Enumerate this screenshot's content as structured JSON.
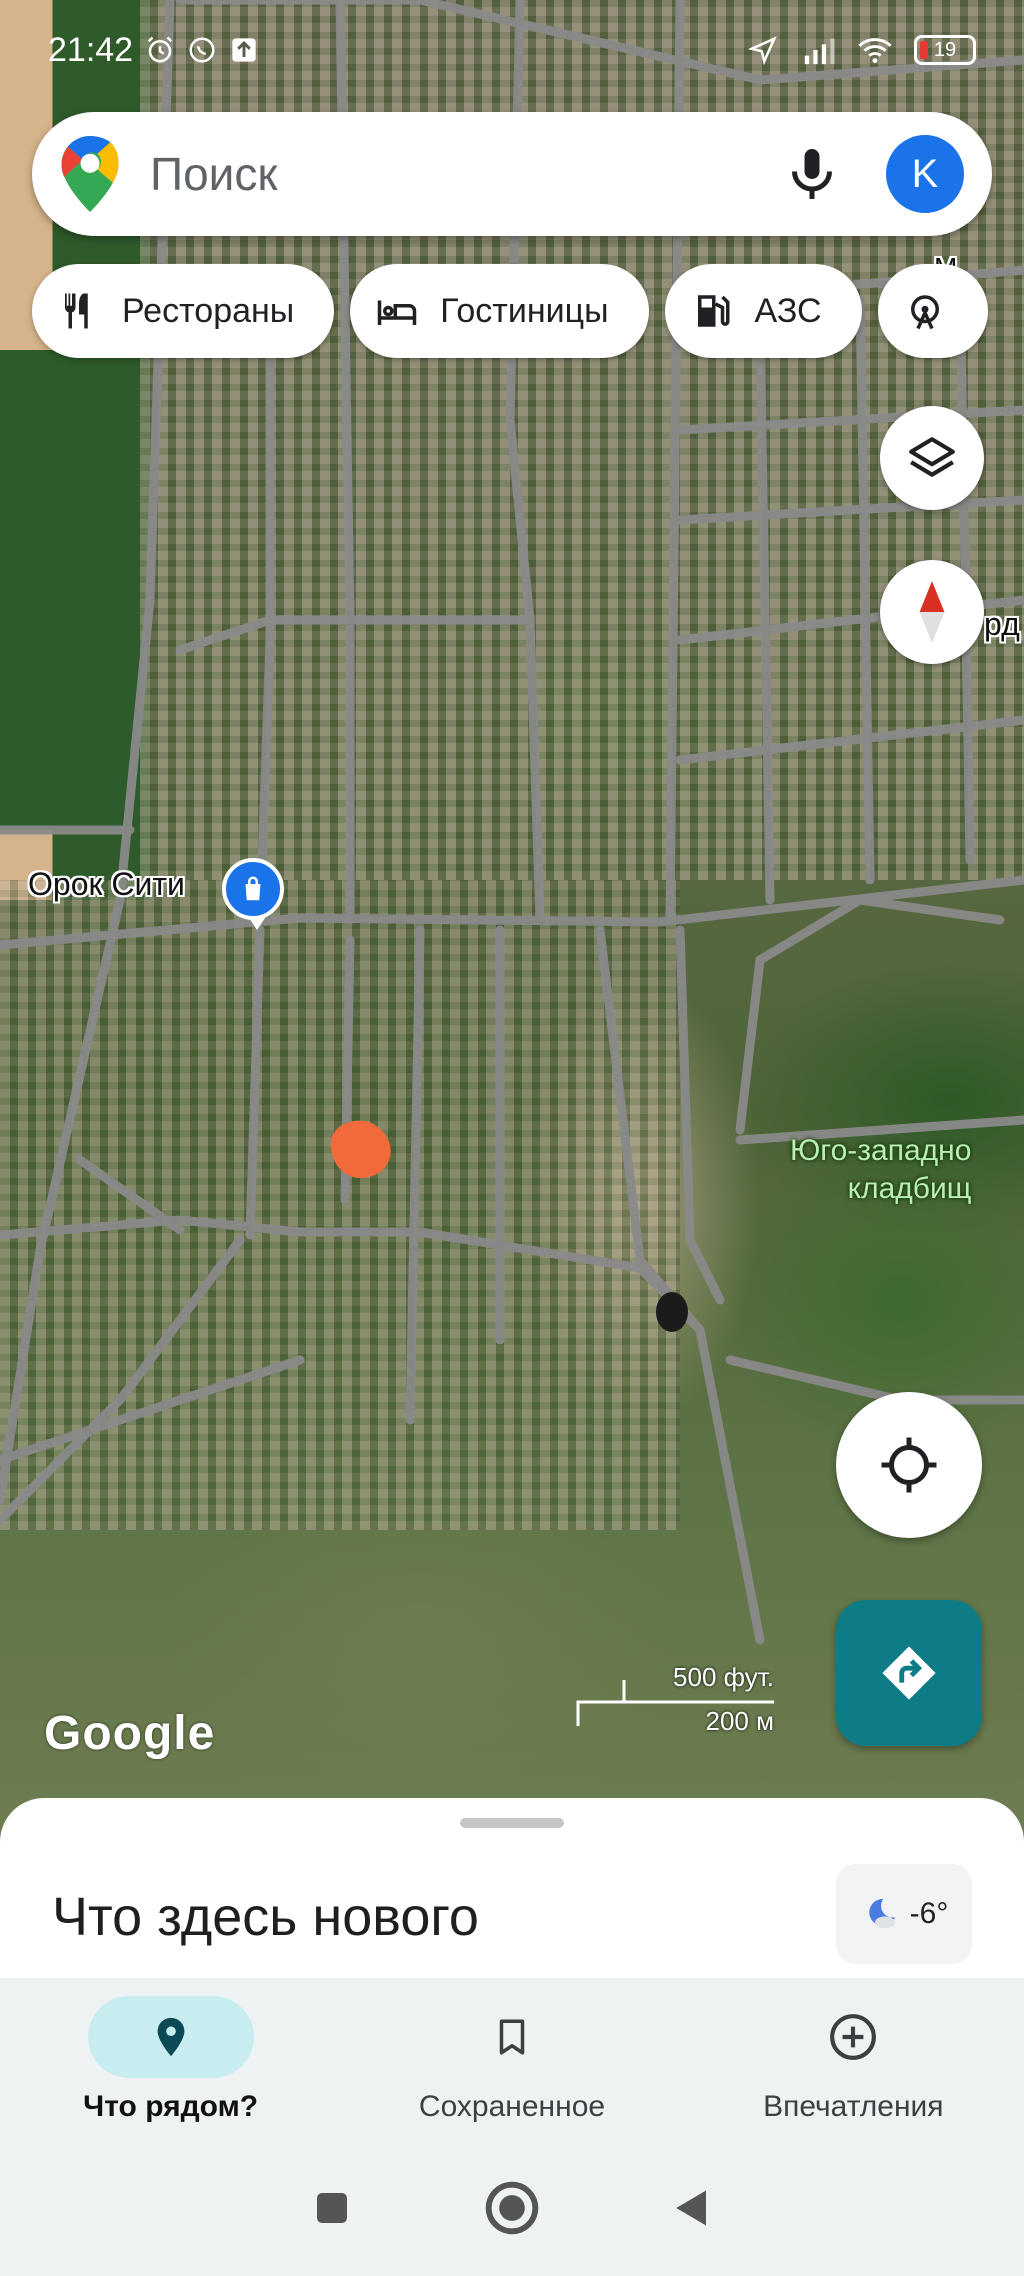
{
  "status_bar": {
    "time": "21:42",
    "battery": "19",
    "icons": [
      "alarm-icon",
      "whatsapp-icon",
      "upload-icon",
      "location-arrow-icon",
      "signal-icon",
      "wifi-icon",
      "battery-icon"
    ]
  },
  "search": {
    "placeholder": "Поиск",
    "avatar_letter": "K",
    "avatar_color": "#1a73e8"
  },
  "chips": [
    {
      "label": "Рестораны",
      "icon": "restaurant-icon"
    },
    {
      "label": "Гостиницы",
      "icon": "hotel-icon"
    },
    {
      "label": "АЗС",
      "icon": "gas-station-icon"
    },
    {
      "label": "",
      "icon": "attraction-icon"
    }
  ],
  "map": {
    "poi_label": "Орок Сити",
    "area_label": "Юго-западно\nкладбищ",
    "edge_label": "рд",
    "edge_label_top": "М",
    "scale_top": "500 фут.",
    "scale_bottom": "200 м",
    "attribution": "Google",
    "marker_color": "#f26a3b"
  },
  "sheet": {
    "title": "Что здесь нового",
    "weather_temp": "-6°",
    "weather_icon": "moon-cloud-icon"
  },
  "bottom_nav": [
    {
      "label": "Что рядом?",
      "icon": "location-pin-icon",
      "active": true
    },
    {
      "label": "Сохраненное",
      "icon": "bookmark-icon",
      "active": false
    },
    {
      "label": "Впечатления",
      "icon": "add-circle-icon",
      "active": false
    }
  ],
  "colors": {
    "accent_teal": "#0e7c86",
    "active_pill": "#c8edf1"
  }
}
